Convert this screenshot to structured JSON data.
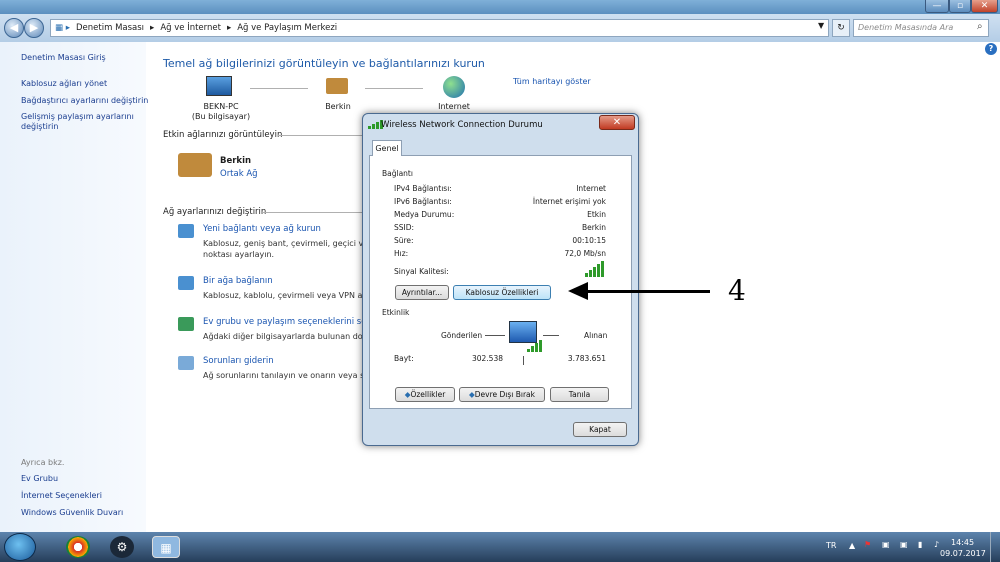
{
  "window": {
    "minimize": "—",
    "maximize": "▫",
    "close": "✕"
  },
  "addressbar": {
    "path": [
      "Denetim Masası",
      "Ağ ve İnternet",
      "Ağ ve Paylaşım Merkezi"
    ],
    "search_placeholder": "Denetim Masasında Ara"
  },
  "sidebar": {
    "home": "Denetim Masası Giriş",
    "items": [
      "Kablosuz ağları yönet",
      "Bağdaştırıcı ayarlarını değiştirin",
      "Gelişmiş paylaşım ayarlarını değiştirin"
    ],
    "see_also": "Ayrıca bkz.",
    "see_also_items": [
      "Ev Grubu",
      "İnternet Seçenekleri",
      "Windows Güvenlik Duvarı"
    ]
  },
  "main": {
    "title": "Temel ağ bilgilerinizi görüntüleyin ve bağlantılarınızı kurun",
    "map_link": "Tüm haritayı göster",
    "nodes": [
      {
        "name": "BEKN-PC",
        "sub": "(Bu bilgisayar)"
      },
      {
        "name": "Berkin",
        "sub": ""
      },
      {
        "name": "Internet",
        "sub": ""
      }
    ],
    "active_header": "Etkin ağlarınızı görüntüleyin",
    "network_name": "Berkin",
    "network_type": "Ortak Ağ",
    "change_header": "Ağ ayarlarınızı değiştirin",
    "tasks": [
      {
        "title": "Yeni bağlantı veya ağ kurun",
        "desc1": "Kablosuz, geniş bant, çevirmeli, geçici ve",
        "desc2": "noktası ayarlayın."
      },
      {
        "title": "Bir ağa bağlanın",
        "desc1": "Kablosuz, kablolu, çevirmeli veya VPN ağ",
        "desc2": ""
      },
      {
        "title": "Ev grubu ve paylaşım seçeneklerini seçin",
        "desc1": "Ağdaki diğer bilgisayarlarda bulunan dos",
        "desc2": ""
      },
      {
        "title": "Sorunları giderin",
        "desc1": "Ağ sorunlarını tanılayın ve onarın veya so",
        "desc2": ""
      }
    ]
  },
  "dialog": {
    "title": "Wireless Network Connection Durumu",
    "close": "✕",
    "tab": "Genel",
    "connection_header": "Bağlantı",
    "rows": [
      {
        "label": "IPv4 Bağlantısı:",
        "value": "Internet"
      },
      {
        "label": "IPv6 Bağlantısı:",
        "value": "İnternet erişimi yok"
      },
      {
        "label": "Medya Durumu:",
        "value": "Etkin"
      },
      {
        "label": "SSID:",
        "value": "Berkin"
      },
      {
        "label": "Süre:",
        "value": "00:10:15"
      },
      {
        "label": "Hız:",
        "value": "72,0 Mb/sn"
      }
    ],
    "signal_label": "Sinyal Kalitesi:",
    "details_btn": "Ayrıntılar...",
    "wireless_btn": "Kablosuz Özellikleri",
    "activity_header": "Etkinlik",
    "sent_label": "Gönderilen",
    "received_label": "Alınan",
    "bytes_label": "Bayt:",
    "bytes_sent": "302.538",
    "bytes_received": "3.783.651",
    "properties_btn": "Özellikler",
    "disable_btn": "Devre Dışı Bırak",
    "diagnose_btn": "Tanıla",
    "close_btn": "Kapat"
  },
  "annotation": {
    "number": "4"
  },
  "taskbar": {
    "lang": "TR",
    "time": "14:45",
    "date": "09.07.2017"
  },
  "help": "?"
}
